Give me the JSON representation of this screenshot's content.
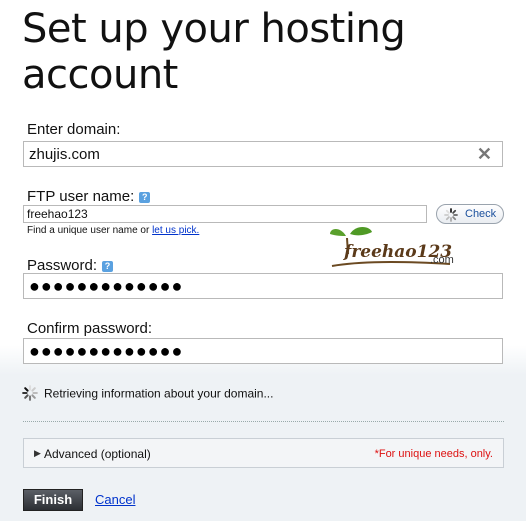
{
  "page": {
    "title": "Set up your hosting account"
  },
  "domain": {
    "label": "Enter domain:",
    "value": "zhujis.com",
    "clear_icon": "close-icon"
  },
  "ftp": {
    "label": "FTP user name:",
    "help_icon": "?",
    "value": "freehao123",
    "check_label": "Check",
    "hint_prefix": "Find a unique user name or",
    "hint_link": "let us pick."
  },
  "password": {
    "label": "Password:",
    "help_icon": "?",
    "value": "●●●●●●●●●●●●●"
  },
  "confirm": {
    "label": "Confirm password:",
    "value": "●●●●●●●●●●●●●"
  },
  "watermark": {
    "text": "freehao123",
    "suffix": ".com"
  },
  "status": {
    "retrieving": "Retrieving information about your domain..."
  },
  "advanced": {
    "label": "Advanced (optional)",
    "note": "*For unique needs, only."
  },
  "actions": {
    "finish": "Finish",
    "cancel": "Cancel"
  },
  "colors": {
    "link": "#0033cc",
    "note": "#dd1111",
    "help": "#5aa1e0",
    "finish_bg": "#2c2f34"
  }
}
